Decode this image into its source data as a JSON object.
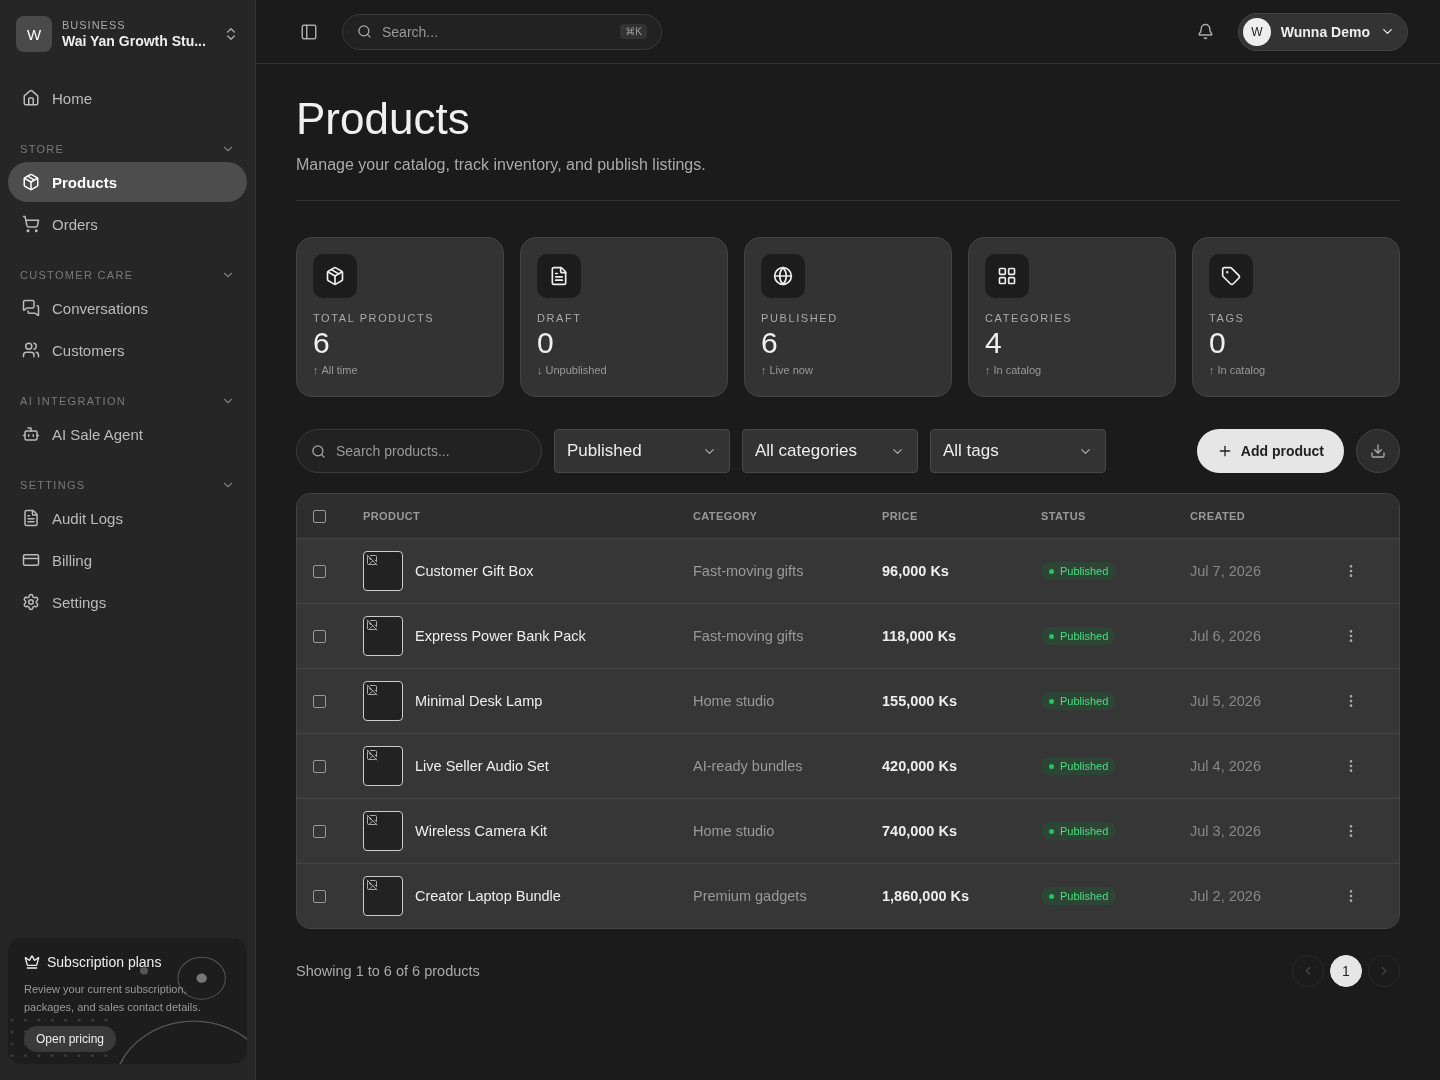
{
  "sidebar": {
    "workspace": {
      "avatar": "W",
      "label": "BUSINESS",
      "name": "Wai Yan Growth Stu..."
    },
    "groups": [
      {
        "items": [
          {
            "label": "Home",
            "selected": false
          }
        ]
      },
      {
        "title": "STORE",
        "expanded": true,
        "items": [
          {
            "label": "Products",
            "selected": true
          },
          {
            "label": "Orders",
            "selected": false
          }
        ]
      },
      {
        "title": "CUSTOMER CARE",
        "expanded": true,
        "items": [
          {
            "label": "Conversations",
            "selected": false
          },
          {
            "label": "Customers",
            "selected": false
          }
        ]
      },
      {
        "title": "AI INTEGRATION",
        "expanded": true,
        "items": [
          {
            "label": "AI Sale Agent",
            "selected": false
          }
        ]
      },
      {
        "title": "SETTINGS",
        "expanded": true,
        "items": [
          {
            "label": "Audit Logs",
            "selected": false
          },
          {
            "label": "Billing",
            "selected": false
          },
          {
            "label": "Settings",
            "selected": false
          }
        ]
      }
    ],
    "promo": {
      "title": "Subscription plans",
      "text": "Review your current subscription, packages, and sales contact details.",
      "button": "Open pricing"
    }
  },
  "topbar": {
    "search": {
      "placeholder": "Search...",
      "shortcut": "⌘K"
    },
    "user": {
      "avatar": "W",
      "name": "Wunna Demo"
    }
  },
  "page": {
    "title": "Products",
    "subtitle": "Manage your catalog, track inventory, and publish listings."
  },
  "stats": [
    {
      "label": "TOTAL PRODUCTS",
      "value": "6",
      "note": "All time",
      "trend": "↑"
    },
    {
      "label": "DRAFT",
      "value": "0",
      "note": "Unpublished",
      "trend": "↓"
    },
    {
      "label": "PUBLISHED",
      "value": "6",
      "note": "Live now",
      "trend": "↑"
    },
    {
      "label": "CATEGORIES",
      "value": "4",
      "note": "In catalog",
      "trend": "↑"
    },
    {
      "label": "TAGS",
      "value": "0",
      "note": "In catalog",
      "trend": "↑"
    }
  ],
  "filters": {
    "search": {
      "placeholder": "Search products..."
    },
    "selects": [
      "Published",
      "All categories",
      "All tags"
    ],
    "add_button": "Add product"
  },
  "table": {
    "select_all": {
      "checked": false
    },
    "columns": [
      "PRODUCT",
      "CATEGORY",
      "PRICE",
      "STATUS",
      "CREATED"
    ],
    "rows": [
      {
        "checked": false,
        "name": "Customer Gift Box",
        "category": "Fast-moving gifts",
        "price": "96,000 Ks",
        "status": "Published",
        "color": "#22c55e",
        "created": "Jul 7, 2026"
      },
      {
        "checked": false,
        "name": "Express Power Bank Pack",
        "category": "Fast-moving gifts",
        "price": "118,000 Ks",
        "status": "Published",
        "color": "#22c55e",
        "created": "Jul 6, 2026"
      },
      {
        "checked": false,
        "name": "Minimal Desk Lamp",
        "category": "Home studio",
        "price": "155,000 Ks",
        "status": "Published",
        "color": "#22c55e",
        "created": "Jul 5, 2026"
      },
      {
        "checked": false,
        "name": "Live Seller Audio Set",
        "category": "AI-ready bundles",
        "price": "420,000 Ks",
        "status": "Published",
        "color": "#22c55e",
        "created": "Jul 4, 2026"
      },
      {
        "checked": false,
        "name": "Wireless Camera Kit",
        "category": "Home studio",
        "price": "740,000 Ks",
        "status": "Published",
        "color": "#22c55e",
        "created": "Jul 3, 2026"
      },
      {
        "checked": false,
        "name": "Creator Laptop Bundle",
        "category": "Premium gadgets",
        "price": "1,860,000 Ks",
        "status": "Published",
        "color": "#22c55e",
        "created": "Jul 2, 2026"
      }
    ]
  },
  "footer": {
    "summary": "Showing 1 to 6 of 6 products",
    "pages": [
      {
        "label": "1",
        "selected": true
      }
    ],
    "prev_disabled": true,
    "next_disabled": true
  }
}
